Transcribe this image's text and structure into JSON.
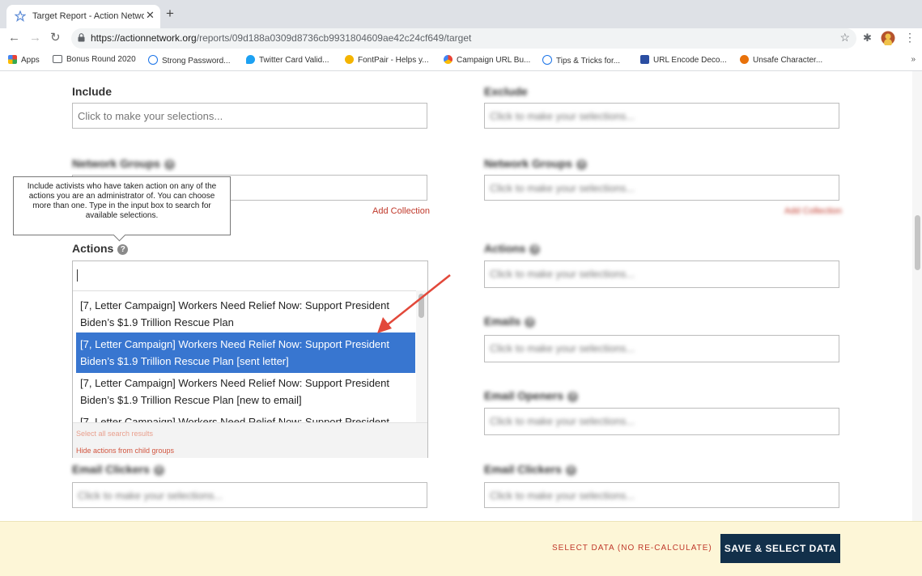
{
  "browser": {
    "tab_title": "Target Report - Action Network",
    "url_domain": "https://actionnetwork.org",
    "url_path": "/reports/09d188a0309d8736cb9931804609ae42c24cf649/target",
    "bookmarks": [
      {
        "label": "Apps",
        "color": "#e94235"
      },
      {
        "label": "Bonus Round 2020",
        "color": "#5f6368"
      },
      {
        "label": "Strong Password...",
        "color": "#1a73e8"
      },
      {
        "label": "Twitter Card Valid...",
        "color": "#1da1f2"
      },
      {
        "label": "FontPair - Helps y...",
        "color": "#f4b400"
      },
      {
        "label": "Campaign URL Bu...",
        "color": "#fbbc04"
      },
      {
        "label": "Tips & Tricks for...",
        "color": "#1a73e8"
      },
      {
        "label": "URL Encode Deco...",
        "color": "#2b4ea2"
      },
      {
        "label": "Unsafe Character...",
        "color": "#e8710a"
      }
    ]
  },
  "include": {
    "label": "Include",
    "placeholder": "Click to make your selections..."
  },
  "blurred": {
    "network_groups_label": "Network Groups",
    "placeholder": "Click to make your selections...",
    "add_collection": "Add Collection",
    "email_clickers_label": "Email Clickers"
  },
  "exclude": {
    "label": "Exclude",
    "network_groups_label": "Network Groups",
    "actions_label": "Actions",
    "emails_label": "Emails",
    "email_openers_label": "Email Openers",
    "email_clickers_label": "Email Clickers",
    "placeholder": "Click to make your selections...",
    "add_collection": "Add Collection"
  },
  "add_collection": "Add Collection",
  "tooltip": "Include activists who have taken action on any of the actions you are an administrator of. You can choose more than one. Type in the input box to search for available selections.",
  "actions": {
    "label": "Actions",
    "options": [
      "[7, Letter Campaign] Workers Need Relief Now: Support President Biden’s $1.9 Trillion Rescue Plan",
      "[7, Letter Campaign] Workers Need Relief Now: Support President Biden’s $1.9 Trillion Rescue Plan [sent letter]",
      "[7, Letter Campaign] Workers Need Relief Now: Support President Biden’s $1.9 Trillion Rescue Plan [new to email]",
      "[7, Letter Campaign] Workers Need Relief Now: Support President"
    ],
    "select_all": "Select all search results",
    "hide_child": "Hide actions from child groups"
  },
  "footer": {
    "select_no_recalc": "SELECT DATA (NO RE-CALCULATE)",
    "save_select": "SAVE & SELECT DATA"
  },
  "colors": {
    "accent_blue": "#3876d0",
    "link_red": "#c0392b",
    "annotation_arrow": "#e2483a",
    "bottom_bar": "#fdf6d7",
    "primary_button": "#12304a"
  }
}
